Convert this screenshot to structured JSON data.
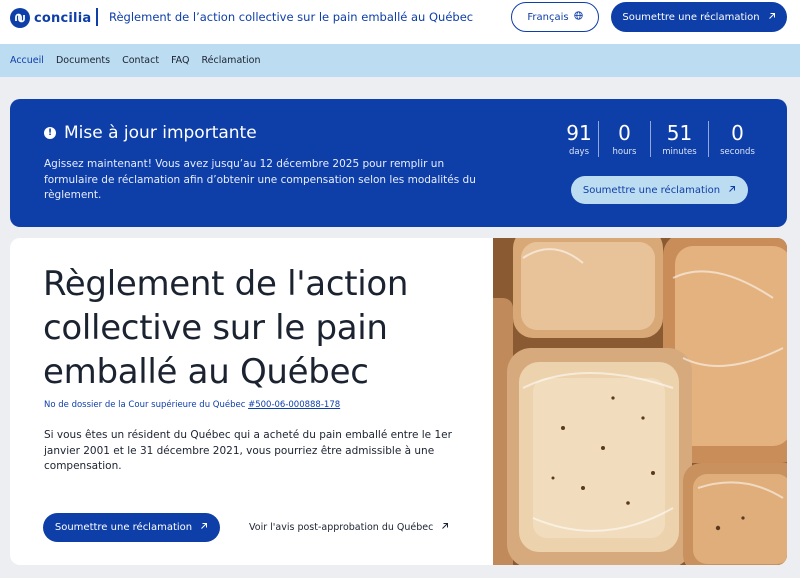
{
  "header": {
    "logo_text": "concilia",
    "title": "Règlement de l’action collective sur le pain emballé au Québec",
    "language_label": "Français",
    "cta_label": "Soumettre une réclamation"
  },
  "nav": {
    "items": [
      "Accueil",
      "Documents",
      "Contact",
      "FAQ",
      "Réclamation"
    ]
  },
  "banner": {
    "title": "Mise à jour importante",
    "text": "Agissez maintenant! Vous avez jusqu’au 12 décembre 2025 pour remplir un formulaire de réclamation afin d’obtenir une compensation selon les modalités du règlement.",
    "countdown": [
      {
        "value": "91",
        "label": "days"
      },
      {
        "value": "0",
        "label": "hours"
      },
      {
        "value": "51",
        "label": "minutes"
      },
      {
        "value": "0",
        "label": "seconds"
      }
    ],
    "cta_label": "Soumettre une réclamation"
  },
  "hero": {
    "title": "Règlement de l'action collective sur le pain emballé au Québec",
    "docket_prefix": "No de dossier de la Cour supérieure du Québec ",
    "docket_number": "#500-06-000888-178",
    "description": "Si vous êtes un résident du Québec qui a acheté du pain emballé entre le 1er janvier 2001 et le 31 décembre 2021, vous pourriez être admissible à une compensation.",
    "cta_label": "Soumettre une réclamation",
    "secondary_link": "Voir l'avis post-approbation du Québec"
  },
  "icons": {
    "logo": "concilia-logo-icon",
    "globe": "globe-icon",
    "arrow": "arrow-up-right-icon",
    "info": "info-icon"
  },
  "colors": {
    "brand": "#0e3ea8",
    "nav_bg": "#bcdcf1",
    "page_bg": "#eceef1"
  }
}
